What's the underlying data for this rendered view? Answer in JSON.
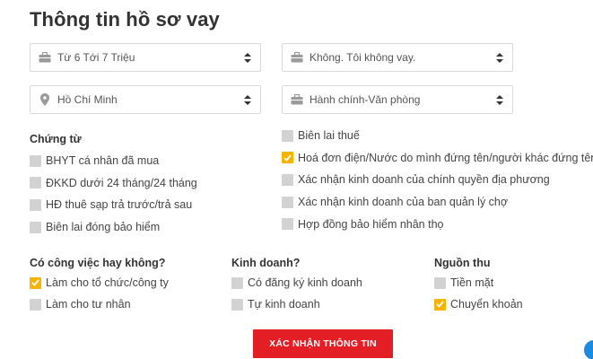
{
  "page": {
    "title": "Thông tin hồ sơ vay"
  },
  "selects": {
    "income": {
      "value": "Từ 6 Tới 7 Triệu",
      "icon": "briefcase-icon"
    },
    "insurance": {
      "value": "Không. Tôi không vay.",
      "icon": "briefcase-icon"
    },
    "city": {
      "value": "Hồ Chí Minh",
      "icon": "location-pin-icon"
    },
    "job_type": {
      "value": "Hành chính-Văn phòng",
      "icon": "briefcase-icon"
    }
  },
  "documents": {
    "heading": "Chứng từ",
    "left": [
      {
        "label": "BHYT cá nhân đã mua",
        "checked": false
      },
      {
        "label": "ĐKKD dưới 24 tháng/24 tháng",
        "checked": false
      },
      {
        "label": "HĐ thuê sạp trả trước/trả sau",
        "checked": false
      },
      {
        "label": "Biên lai đóng bảo hiểm",
        "checked": false
      }
    ],
    "right": [
      {
        "label": "Biên lai thuế",
        "checked": false
      },
      {
        "label": "Hoá đơn điện/Nước do mình đứng tên/người khác đứng tên",
        "checked": true
      },
      {
        "label": "Xác nhận kinh doanh của chính quyền địa phương",
        "checked": false
      },
      {
        "label": "Xác nhận kinh doanh của ban quản lý chợ",
        "checked": false
      },
      {
        "label": "Hợp đồng bảo hiểm nhân thọ",
        "checked": false
      }
    ]
  },
  "employment": {
    "heading": "Có công việc hay không?",
    "options": [
      {
        "label": "Làm cho tổ chức/công ty",
        "checked": true
      },
      {
        "label": "Làm cho tư nhân",
        "checked": false
      }
    ]
  },
  "business": {
    "heading": "Kinh doanh?",
    "options": [
      {
        "label": "Có đăng ký kinh doanh",
        "checked": false
      },
      {
        "label": "Tự kinh doanh",
        "checked": false
      }
    ]
  },
  "income_source": {
    "heading": "Nguồn thu",
    "options": [
      {
        "label": "Tiền mặt",
        "checked": false
      },
      {
        "label": "Chuyển khoản",
        "checked": true
      }
    ]
  },
  "submit": {
    "label": "XÁC NHẬN THÔNG TIN"
  },
  "colors": {
    "accent": "#e31e24",
    "checked": "#f4b400",
    "unchecked": "#d2d2d2",
    "chat": "#1a8be0"
  }
}
